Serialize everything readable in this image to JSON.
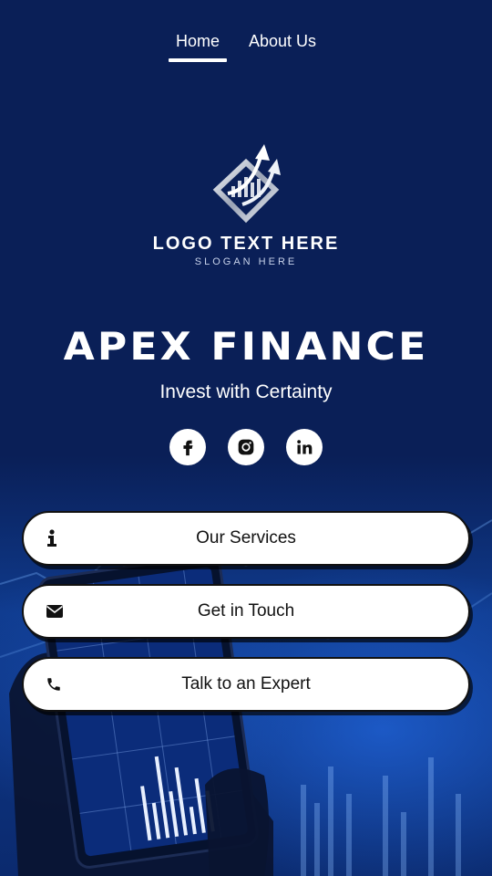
{
  "nav": {
    "tabs": [
      {
        "label": "Home",
        "active": true
      },
      {
        "label": "About Us",
        "active": false
      }
    ]
  },
  "logo": {
    "text": "LOGO TEXT HERE",
    "slogan": "SLOGAN HERE"
  },
  "brand": {
    "title": "APEX FINANCE",
    "tagline": "Invest with Certainty"
  },
  "socials": [
    {
      "icon": "facebook-icon"
    },
    {
      "icon": "instagram-icon"
    },
    {
      "icon": "linkedin-icon"
    }
  ],
  "buttons": [
    {
      "label": "Our Services",
      "icon": "info-icon"
    },
    {
      "label": "Get in Touch",
      "icon": "envelope-icon"
    },
    {
      "label": "Talk to an Expert",
      "icon": "phone-icon"
    }
  ],
  "colors": {
    "background": "#0a1f57",
    "button": "#ffffff",
    "text": "#ffffff"
  }
}
